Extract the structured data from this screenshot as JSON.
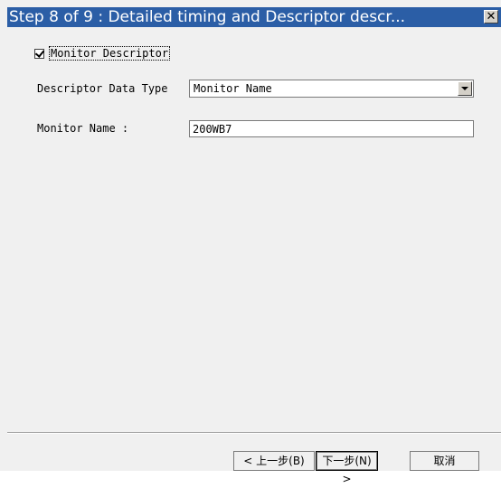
{
  "window": {
    "title": "Step 8 of 9 : Detailed timing and Descriptor descr...",
    "close_glyph": "✕"
  },
  "form": {
    "monitor_descriptor_label": "Monitor Descriptor",
    "monitor_descriptor_checked": true,
    "descriptor_type_label": "Descriptor Data Type",
    "descriptor_type_value": "Monitor Name",
    "monitor_name_label": "Monitor Name :",
    "monitor_name_value": "200WB7"
  },
  "buttons": {
    "prev_label": "< 上一步(B)",
    "next_label": "下一步(N) >",
    "cancel_label": "取消"
  },
  "colors": {
    "titlebar": "#2b5ea6",
    "background": "#f0f0f0"
  }
}
